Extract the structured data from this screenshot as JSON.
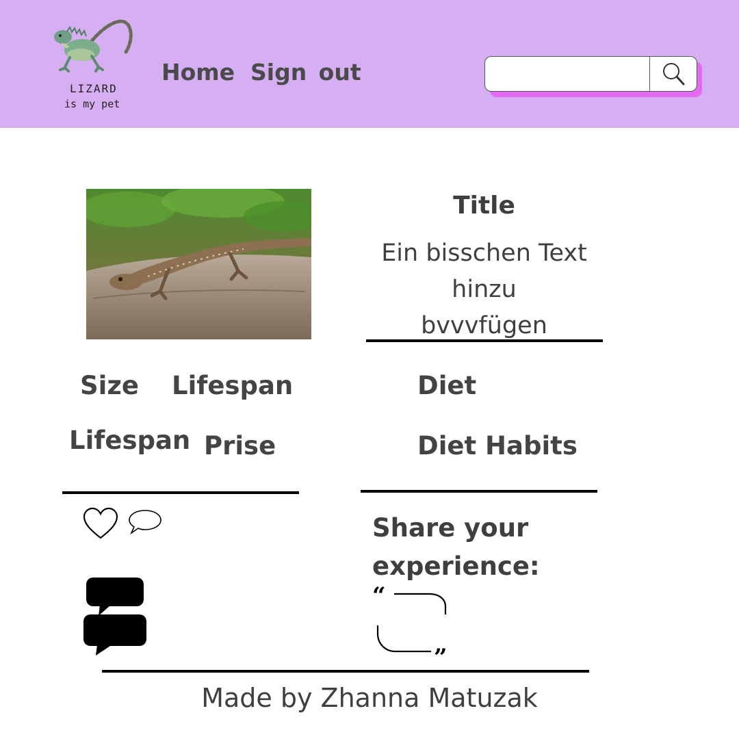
{
  "header": {
    "logo": {
      "line1": "LIZARD",
      "line2": "is my pet"
    },
    "nav": {
      "home": "Home",
      "sign_out": "Sign  out"
    },
    "search": {
      "value": "",
      "placeholder": ""
    },
    "colors": {
      "bg": "#d6aef2",
      "search_shadow": "#e26bf2"
    }
  },
  "main": {
    "title": "Title",
    "description_lines": [
      "Ein bisschen Text",
      "hinzu",
      "bvvvfügen"
    ],
    "facts": {
      "size": "Size",
      "lifespan_top": "Lifespan",
      "lifespan_bottom": "Lifespan",
      "price": "Prise",
      "diet": "Diet",
      "diet_habits": "Diet Habits"
    },
    "share_heading_lines": [
      "Share your",
      "experience:"
    ]
  },
  "icons": [
    "lizard-logo-icon",
    "search-icon",
    "heart-icon",
    "comment-icon",
    "chat-bubbles-icon",
    "quote-open-icon",
    "quote-close-icon"
  ],
  "footer": {
    "credit": "Made by Zhanna Matuzak"
  }
}
